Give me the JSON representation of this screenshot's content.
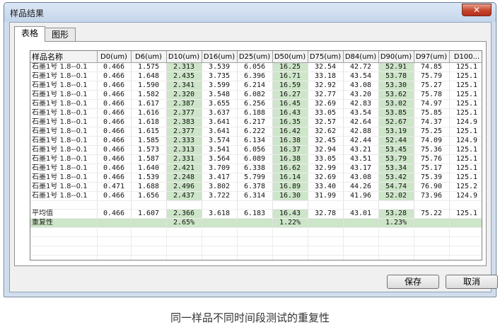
{
  "window": {
    "title": "样品结果",
    "close_glyph": "✕"
  },
  "tabs": [
    {
      "label": "表格"
    },
    {
      "label": "图形"
    }
  ],
  "table": {
    "headers": [
      "样品名称",
      "D0(um)",
      "D6(um)",
      "D10(um)",
      "D16(um)",
      "D25(um)",
      "D50(um)",
      "D75(um)",
      "D84(um)",
      "D90(um)",
      "D97(um)",
      "D100..."
    ],
    "rows": [
      [
        "石墨1号  1.8--0.1",
        "0.466",
        "1.575",
        "2.313",
        "3.539",
        "6.056",
        "16.25",
        "32.54",
        "42.72",
        "52.91",
        "74.85",
        "125.1"
      ],
      [
        "石墨1号  1.8--0.1",
        "0.466",
        "1.648",
        "2.435",
        "3.735",
        "6.396",
        "16.71",
        "33.18",
        "43.54",
        "53.78",
        "75.79",
        "125.1"
      ],
      [
        "石墨1号  1.8--0.1",
        "0.466",
        "1.590",
        "2.341",
        "3.599",
        "6.214",
        "16.59",
        "32.92",
        "43.08",
        "53.30",
        "75.27",
        "125.1"
      ],
      [
        "石墨1号  1.8--0.1",
        "0.466",
        "1.582",
        "2.320",
        "3.548",
        "6.082",
        "16.27",
        "32.77",
        "43.20",
        "53.62",
        "75.78",
        "125.1"
      ],
      [
        "石墨1号  1.8--0.1",
        "0.466",
        "1.617",
        "2.387",
        "3.655",
        "6.256",
        "16.45",
        "32.69",
        "42.83",
        "53.02",
        "74.97",
        "125.1"
      ],
      [
        "石墨1号  1.8--0.1",
        "0.466",
        "1.616",
        "2.377",
        "3.637",
        "6.188",
        "16.43",
        "33.05",
        "43.54",
        "53.85",
        "75.85",
        "125.1"
      ],
      [
        "石墨1号  1.8--0.1",
        "0.466",
        "1.618",
        "2.383",
        "3.641",
        "6.217",
        "16.35",
        "32.57",
        "42.64",
        "52.67",
        "74.37",
        "124.9"
      ],
      [
        "石墨1号  1.8--0.1",
        "0.466",
        "1.615",
        "2.377",
        "3.641",
        "6.222",
        "16.42",
        "32.62",
        "42.88",
        "53.19",
        "75.25",
        "125.1"
      ],
      [
        "石墨1号  1.8--0.1",
        "0.466",
        "1.585",
        "2.333",
        "3.574",
        "6.134",
        "16.38",
        "32.45",
        "42.44",
        "52.44",
        "74.09",
        "124.9"
      ],
      [
        "石墨1号  1.8--0.1",
        "0.466",
        "1.573",
        "2.313",
        "3.541",
        "6.056",
        "16.37",
        "32.94",
        "43.21",
        "53.45",
        "75.36",
        "125.1"
      ],
      [
        "石墨1号  1.8--0.1",
        "0.466",
        "1.587",
        "2.331",
        "3.564",
        "6.089",
        "16.38",
        "33.05",
        "43.51",
        "53.79",
        "75.76",
        "125.1"
      ],
      [
        "石墨1号  1.8--0.1",
        "0.466",
        "1.640",
        "2.421",
        "3.709",
        "6.338",
        "16.62",
        "32.99",
        "43.17",
        "53.34",
        "75.17",
        "125.1"
      ],
      [
        "石墨1号  1.8--0.1",
        "0.466",
        "1.539",
        "2.248",
        "3.417",
        "5.799",
        "16.14",
        "32.69",
        "43.08",
        "53.42",
        "75.39",
        "125.1"
      ],
      [
        "石墨1号  1.8--0.1",
        "0.471",
        "1.688",
        "2.496",
        "3.802",
        "6.378",
        "16.89",
        "33.40",
        "44.26",
        "54.74",
        "76.90",
        "125.2"
      ],
      [
        "石墨1号  1.8--0.1",
        "0.466",
        "1.656",
        "2.437",
        "3.722",
        "6.314",
        "16.30",
        "31.99",
        "41.96",
        "52.02",
        "73.96",
        "124.9"
      ]
    ],
    "average": [
      "平均值",
      "0.466",
      "1.607",
      "2.366",
      "3.618",
      "6.183",
      "16.43",
      "32.78",
      "43.01",
      "53.28",
      "75.22",
      "125.1"
    ],
    "repeatability": {
      "label": "重复性",
      "d10": "2.65%",
      "d50": "1.22%",
      "d90": "1.23%"
    },
    "highlight_color": "#cde5c8"
  },
  "buttons": {
    "save": "保存",
    "cancel": "取消"
  },
  "caption": "同一样品不同时间段测试的重复性"
}
